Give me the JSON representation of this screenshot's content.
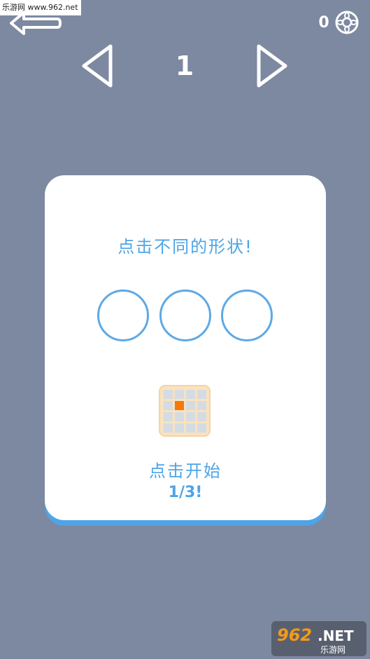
{
  "watermark": {
    "top_text": "乐游网 www.962.net",
    "logo_top": "962.NET",
    "logo_bottom": "乐游网"
  },
  "header": {
    "coin_count": "0",
    "level_number": "1",
    "icons": {
      "back": "back-arrow-icon",
      "coin": "coin-icon",
      "prev": "triangle-left-icon",
      "next": "triangle-right-icon"
    }
  },
  "card": {
    "instruction": "点击不同的形状!",
    "shapes": [
      "circle",
      "circle",
      "circle"
    ],
    "start_label": "点击开始",
    "progress_label": "1/3!",
    "icon": "grid-icon"
  },
  "colors": {
    "background": "#7d88a1",
    "card": "#ffffff",
    "accent": "#4ea4e6",
    "highlight_cell": "#f4780f"
  }
}
